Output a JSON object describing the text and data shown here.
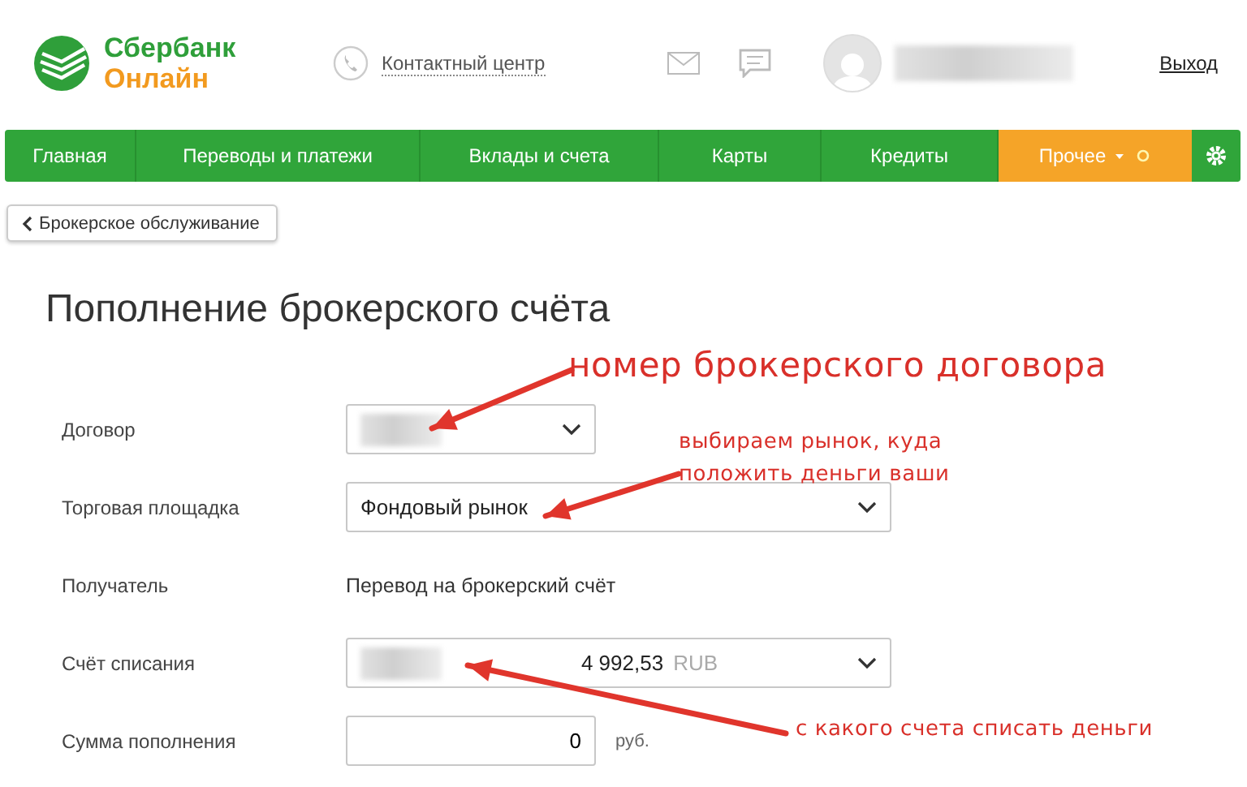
{
  "header": {
    "logo_top": "Сбербанк",
    "logo_bottom": "Онлайн",
    "contact": "Контактный центр",
    "logout": "Выход"
  },
  "nav": [
    {
      "label": "Главная",
      "selected": false
    },
    {
      "label": "Переводы и платежи",
      "selected": false
    },
    {
      "label": "Вклады и счета",
      "selected": false
    },
    {
      "label": "Карты",
      "selected": false
    },
    {
      "label": "Кредиты",
      "selected": false
    },
    {
      "label": "Прочее",
      "selected": true
    }
  ],
  "back": "Брокерское обслуживание",
  "title": "Пополнение брокерского счёта",
  "form": [
    {
      "label": "Договор",
      "kind": "select"
    },
    {
      "label": "Торговая площадка",
      "kind": "select",
      "value": "Фондовый рынок"
    },
    {
      "label": "Получатель",
      "kind": "text",
      "value": "Перевод на брокерский счёт"
    },
    {
      "label": "Счёт списания",
      "kind": "select",
      "amount": "4 992,53",
      "currency": "RUB"
    },
    {
      "label": "Сумма пополнения",
      "kind": "input",
      "value": "0",
      "unit": "руб."
    }
  ],
  "annotations": [
    {
      "lines": [
        "номер брокерского договора"
      ]
    },
    {
      "lines": [
        "выбираем рынок, куда",
        "положить деньги ваши"
      ]
    },
    {
      "lines": [
        "с какого счета списать деньги"
      ]
    }
  ]
}
